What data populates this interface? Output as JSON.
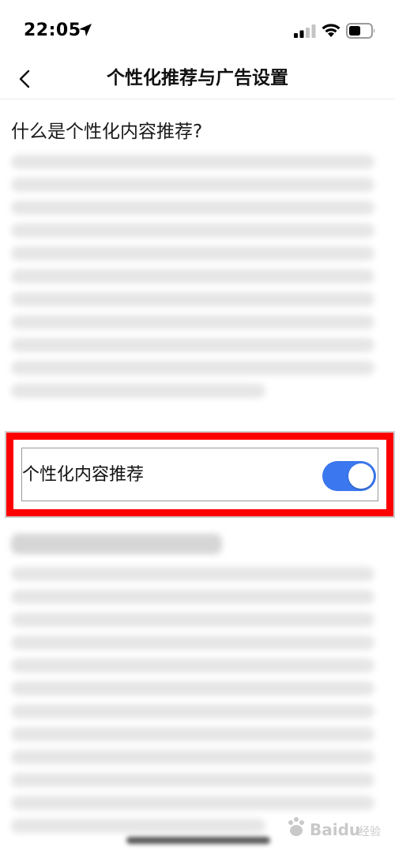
{
  "status_bar": {
    "time": "22:05",
    "icons": [
      "location-arrow-icon",
      "cellular-signal-icon",
      "wifi-icon",
      "battery-icon"
    ]
  },
  "nav": {
    "back_icon": "chevron-left-icon",
    "title": "个性化推荐与广告设置"
  },
  "content": {
    "section_heading": "什么是个性化内容推荐?",
    "toggle": {
      "label": "个性化内容推荐",
      "enabled": true,
      "on_color": "#3b77ee"
    }
  },
  "annotation": {
    "highlight_color": "#ff0000"
  },
  "watermark": {
    "text": "Baidu 经验"
  }
}
